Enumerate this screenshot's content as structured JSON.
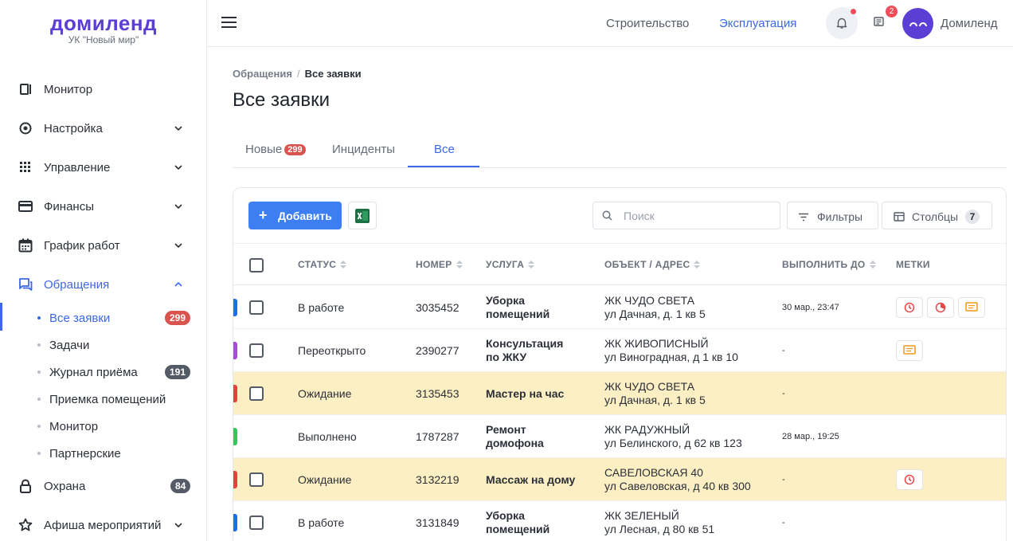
{
  "logo": {
    "title": "домиленд",
    "subtitle": "УК \"Новый мир\""
  },
  "sidebar": {
    "items": [
      {
        "label": "Монитор",
        "icon": "monitor-icon"
      },
      {
        "label": "Настройка",
        "icon": "settings-icon"
      },
      {
        "label": "Управление",
        "icon": "grid-icon"
      },
      {
        "label": "Финансы",
        "icon": "card-icon"
      },
      {
        "label": "График работ",
        "icon": "calendar-icon"
      },
      {
        "label": "Обращения",
        "icon": "chat-icon"
      },
      {
        "label": "Охрана",
        "icon": "lock-icon",
        "badge": "84"
      },
      {
        "label": "Афиша мероприятий",
        "icon": "star-icon"
      }
    ],
    "subitems": [
      {
        "label": "Все заявки",
        "badge": "299"
      },
      {
        "label": "Задачи"
      },
      {
        "label": "Журнал приёма",
        "badge": "191"
      },
      {
        "label": "Приемка помещений"
      },
      {
        "label": "Монитор"
      },
      {
        "label": "Партнерские"
      }
    ]
  },
  "header": {
    "link_build": "Строительство",
    "link_ops": "Эксплуатация",
    "news_count": "2",
    "username": "Домиленд"
  },
  "breadcrumb": {
    "parent": "Обращения",
    "separator": "/",
    "current": "Все заявки"
  },
  "page_title": "Все заявки",
  "tabs": [
    {
      "label": "Новые",
      "badge": "299"
    },
    {
      "label": "Инциденты"
    },
    {
      "label": "Все"
    }
  ],
  "toolbar": {
    "add_label": "Добавить",
    "search_placeholder": "Поиск",
    "filters_label": "Фильтры",
    "columns_label": "Столбцы",
    "columns_count": "7"
  },
  "table": {
    "columns": [
      "СТАТУС",
      "НОМЕР",
      "УСЛУГА",
      "ОБЪЕКТ / АДРЕС",
      "ВЫПОЛНИТЬ ДО",
      "МЕТКИ"
    ],
    "rows": [
      {
        "status": "В работе",
        "status_color": "#1e6ff0",
        "number": "3035452",
        "service": [
          "Уборка",
          "помещений"
        ],
        "object": "ЖК ЧУДО СВЕТА",
        "address": "ул Дачная, д. 1 кв 5",
        "due": "30 мар., 23:47",
        "marks": [
          "clock-icon",
          "timer-icon",
          "comment-icon"
        ],
        "highlight": false,
        "checkbox": true
      },
      {
        "status": "Переоткрыто",
        "status_color": "#a44fd6",
        "number": "2390277",
        "service": [
          "Консультация",
          "по ЖКУ"
        ],
        "object": "ЖК ЖИВОПИСНЫЙ",
        "address": "ул Виноградная, д 1 кв 10",
        "due": "-",
        "marks": [
          "comment-icon"
        ],
        "highlight": false,
        "checkbox": true
      },
      {
        "status": "Ожидание",
        "status_color": "#ee3d3d",
        "number": "3135453",
        "service": [
          "Мастер на час"
        ],
        "object": "ЖК ЧУДО СВЕТА",
        "address": "ул Дачная, д. 1 кв 5",
        "due": "-",
        "marks": [],
        "highlight": true,
        "checkbox": true
      },
      {
        "status": "Выполнено",
        "status_color": "#3cc45a",
        "number": "1787287",
        "service": [
          "Ремонт",
          "домофона"
        ],
        "object": "ЖК РАДУЖНЫЙ",
        "address": "ул Белинского, д 62 кв 123",
        "due": "28 мар., 19:25",
        "marks": [],
        "highlight": false,
        "checkbox": false
      },
      {
        "status": "Ожидание",
        "status_color": "#ee3d3d",
        "number": "3132219",
        "service": [
          "Массаж на дому"
        ],
        "object": "САВЕЛОВСКАЯ 40",
        "address": "ул Савеловская, д 40 кв 300",
        "due": "-",
        "marks": [
          "clock-icon"
        ],
        "highlight": true,
        "checkbox": true
      },
      {
        "status": "В работе",
        "status_color": "#1e6ff0",
        "number": "3131849",
        "service": [
          "Уборка",
          "помещений"
        ],
        "object": "ЖК ЗЕЛЕНЫЙ",
        "address": "ул Лесная, д 80 кв 51",
        "due": "-",
        "marks": [],
        "highlight": false,
        "checkbox": true
      }
    ]
  },
  "colors": {
    "accent": "#3d68e6",
    "brand": "#5b3fd4",
    "highlight_row": "#fcefc3",
    "badge_red": "#d9534f"
  }
}
